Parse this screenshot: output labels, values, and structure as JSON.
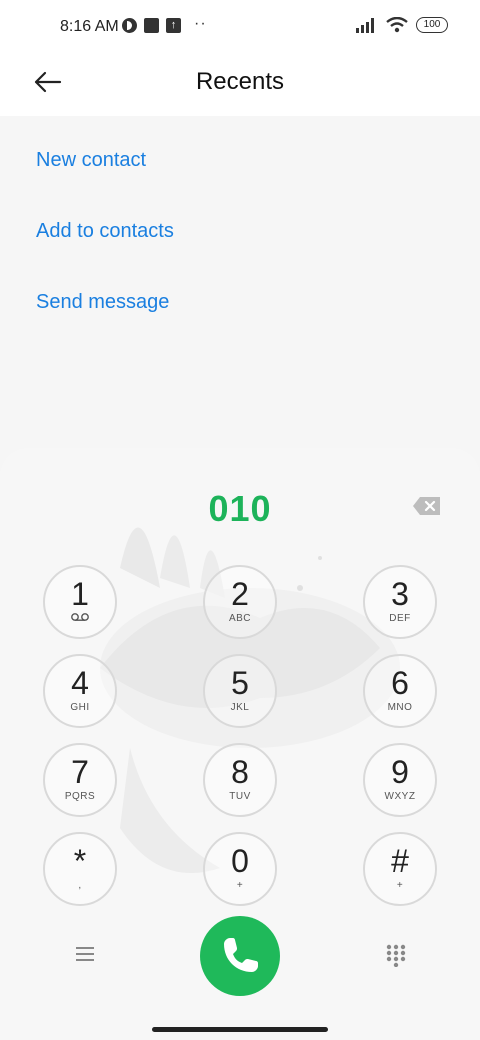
{
  "status_bar": {
    "time": "8:16 AM",
    "battery": "100",
    "icons": [
      "app-circle-icon",
      "square-icon",
      "upload-icon",
      "more-dots-icon",
      "signal-icon",
      "wifi-icon",
      "battery-icon"
    ]
  },
  "header": {
    "title": "Recents",
    "back_icon": "arrow-left-icon"
  },
  "actions": [
    {
      "label": "New contact"
    },
    {
      "label": "Add to contacts"
    },
    {
      "label": "Send message"
    }
  ],
  "dialer": {
    "number": "010",
    "keys": [
      {
        "digit": "1",
        "letters": "voicemail-icon"
      },
      {
        "digit": "2",
        "letters": "ABC"
      },
      {
        "digit": "3",
        "letters": "DEF"
      },
      {
        "digit": "4",
        "letters": "GHI"
      },
      {
        "digit": "5",
        "letters": "JKL"
      },
      {
        "digit": "6",
        "letters": "MNO"
      },
      {
        "digit": "7",
        "letters": "PQRS"
      },
      {
        "digit": "8",
        "letters": "TUV"
      },
      {
        "digit": "9",
        "letters": "WXYZ"
      },
      {
        "digit": "*",
        "letters": ","
      },
      {
        "digit": "0",
        "letters": "+"
      },
      {
        "digit": "#",
        "letters": "+"
      }
    ],
    "call_color": "#1fb95a",
    "number_color": "#1db35a"
  },
  "colors": {
    "accent_link": "#1a7fe0"
  }
}
